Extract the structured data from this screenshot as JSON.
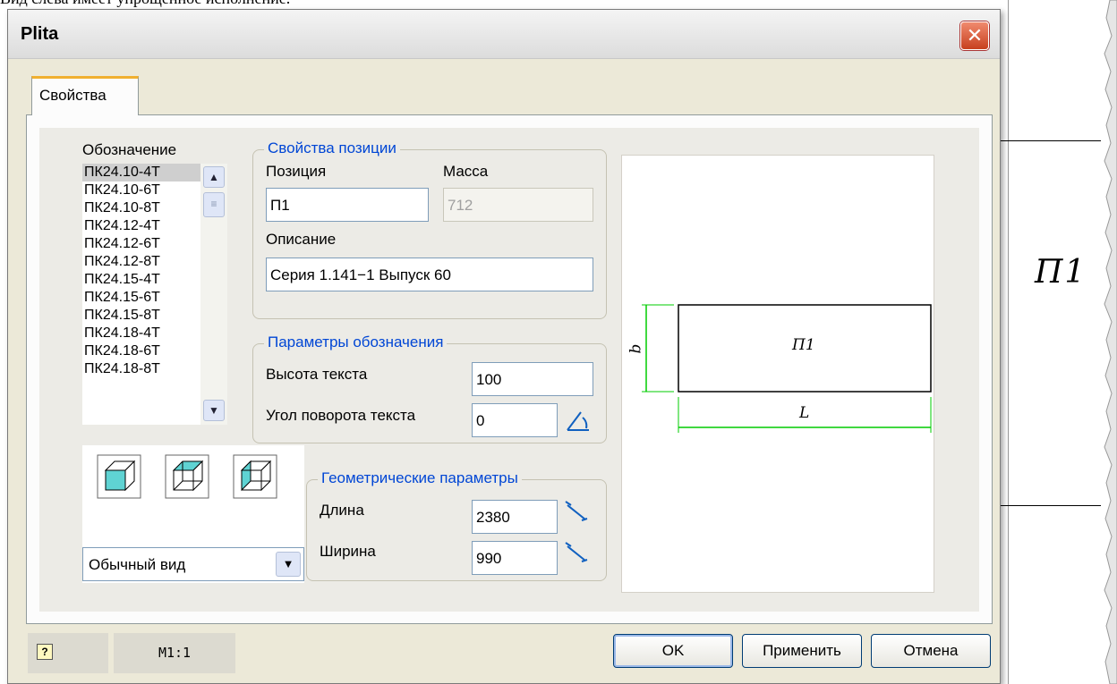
{
  "page": {
    "top_caption": "Вид слева имеет упрощенное исполнение."
  },
  "drawing": {
    "label": "П1"
  },
  "window": {
    "title": "Plita",
    "close_glyph": "✕"
  },
  "tabs": [
    {
      "label": "Свойства",
      "active": true
    }
  ],
  "designation": {
    "label": "Обозначение",
    "items": [
      "ПК24.10-4Т",
      "ПК24.10-6Т",
      "ПК24.10-8Т",
      "ПК24.12-4Т",
      "ПК24.12-6Т",
      "ПК24.12-8Т",
      "ПК24.15-4Т",
      "ПК24.15-6Т",
      "ПК24.15-8Т",
      "ПК24.18-4Т",
      "ПК24.18-6Т",
      "ПК24.18-8Т"
    ],
    "selected_index": 0
  },
  "view": {
    "options_icons": [
      "cube-solid-front-icon",
      "cube-wireframe-icon",
      "cube-side-face-icon"
    ],
    "combo_value": "Обычный вид"
  },
  "position_props": {
    "legend": "Свойства позиции",
    "position_label": "Позиция",
    "position_value": "П1",
    "mass_label": "Масса",
    "mass_value": "712",
    "description_label": "Описание",
    "description_value": "Серия 1.141−1 Выпуск 60"
  },
  "designation_params": {
    "legend": "Параметры обозначения",
    "text_height_label": "Высота текста",
    "text_height_value": "100",
    "text_angle_label": "Угол поворота текста",
    "text_angle_value": "0"
  },
  "geometry": {
    "legend": "Геометрические параметры",
    "length_label": "Длина",
    "length_value": "2380",
    "width_label": "Ширина",
    "width_value": "990"
  },
  "preview": {
    "center_label": "П1",
    "width_dim_label": "b",
    "length_dim_label": "L",
    "dim_color": "#00cc00"
  },
  "status": {
    "help_glyph": "?",
    "scale": "M1:1"
  },
  "buttons": {
    "ok": "OK",
    "apply": "Применить",
    "cancel": "Отмена"
  },
  "colors": {
    "accent_tab": "#f0b030",
    "legend_text": "#0046d5",
    "cube_face": "#5fd3d3"
  }
}
